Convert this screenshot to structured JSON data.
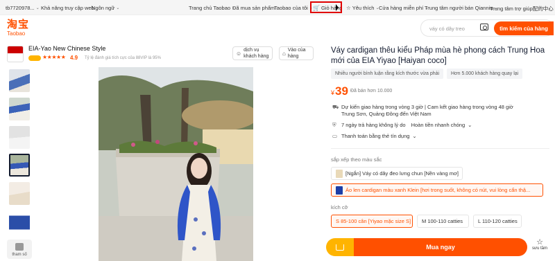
{
  "topbar": {
    "account": "tb7720978...",
    "accessibility": "Khả năng truy cập web",
    "language": "Ngôn ngữ",
    "home": "Trang chủ Taobao",
    "purchased": "Đã mua sản phẩm",
    "my_taobao": "Taobao của tôi",
    "cart": "Giỏ hàng",
    "favorites": "Yêu thích",
    "free_store": "Cửa hàng miễn phí",
    "seller_center": "Trung tâm người bán Qianniu",
    "help_center": "Trung tâm trợ giúp配的中心"
  },
  "header": {
    "logo_cn": "淘宝",
    "logo_en": "Taobao",
    "search_placeholder": "váy có dây treo",
    "search_button": "tìm kiếm của hàng"
  },
  "shop": {
    "name": "EIA-Yao New Chinese Style",
    "stars": "★★★★★",
    "rating": "4.9",
    "subtitle": "Tỷ lệ đánh giá tích cực của 88VIP là 95%",
    "service_button": "dịch vụ khách hàng",
    "enter_store_button": "Vào của hàng"
  },
  "gallery": {
    "more_label": "tham số"
  },
  "product": {
    "title": "Váy cardigan thêu kiểu Pháp mùa hè phong cách Trung Hoa mới của EIA Yiyao [Haiyan coco]",
    "tags": [
      "Nhiều người bình luận rằng kích thước vừa phải",
      "Hơn 5.000 khách hàng quay lại"
    ],
    "currency": "¥",
    "price": "39",
    "sold": "Đã bán hơn 10.000",
    "delivery": "Dự kiến giao hàng trong vòng 3 giờ | Cam kết giao hàng trong vòng 48 giờ",
    "origin": "Trung Sơn, Quảng Đông đến Việt Nam",
    "return_policy": "7 ngày trả hàng không lý do",
    "refund": "Hoàn tiền nhanh chóng",
    "payment": "Thanh toán bằng thẻ tín dụng",
    "sort_label": "sắp xếp theo màu sắc",
    "options": [
      {
        "label": "[Ngắn] Váy có dây đeo lưng chun [Nền vàng mơ]",
        "swatch": "#e9d9b8"
      },
      {
        "label": "Áo len cardigan màu xanh Klein [hơi trong suốt, không có nút, vui lòng cẩn thậ...",
        "swatch": "#1d3fa8"
      }
    ],
    "size_label": "kích cỡ",
    "sizes": [
      "S 85-100 cân [Yiyao mặc size S]",
      "M 100-110 catties",
      "L 110-120 catties"
    ],
    "buy_now": "Mua ngay",
    "favorite": "sưu tầm"
  },
  "colors": {
    "accent": "#ff5000",
    "cart_highlight": "#e00000"
  }
}
